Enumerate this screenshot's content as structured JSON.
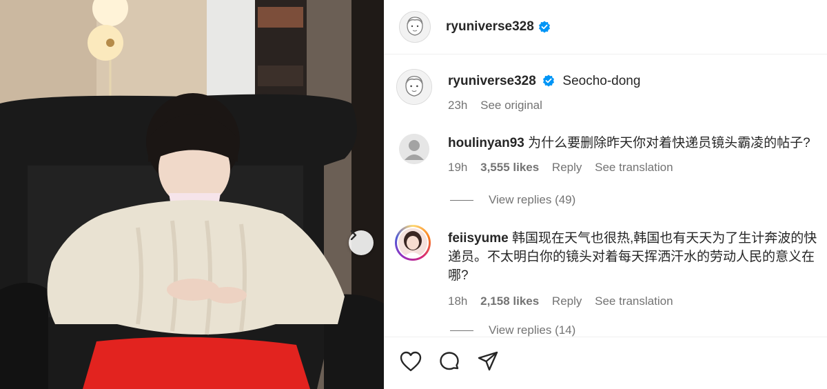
{
  "post": {
    "author": "ryuniverse328",
    "location": "Seocho-dong",
    "time": "23h",
    "see_original": "See original"
  },
  "comments": [
    {
      "username": "houlinyan93",
      "text": "为什么要删除昨天你对着快递员镜头霸凌的帖子?",
      "time": "19h",
      "likes": "3,555 likes",
      "reply": "Reply",
      "translate": "See translation",
      "view_replies": "View replies (49)"
    },
    {
      "username": "feiisyume",
      "text": "韩国现在天气也很热,韩国也有天天为了生计奔波的快递员。不太明白你的镜头对着每天挥洒汗水的劳动人民的意义在哪?",
      "time": "18h",
      "likes": "2,158 likes",
      "reply": "Reply",
      "translate": "See translation",
      "view_replies": "View replies (14)"
    }
  ],
  "colors": {
    "verified": "#0095f6",
    "sweater": "#e9e2d2",
    "pants": "#e2231f"
  },
  "icons": [
    "heart-icon",
    "comment-icon",
    "share-icon",
    "chevron-right-icon",
    "verified-badge-icon"
  ]
}
